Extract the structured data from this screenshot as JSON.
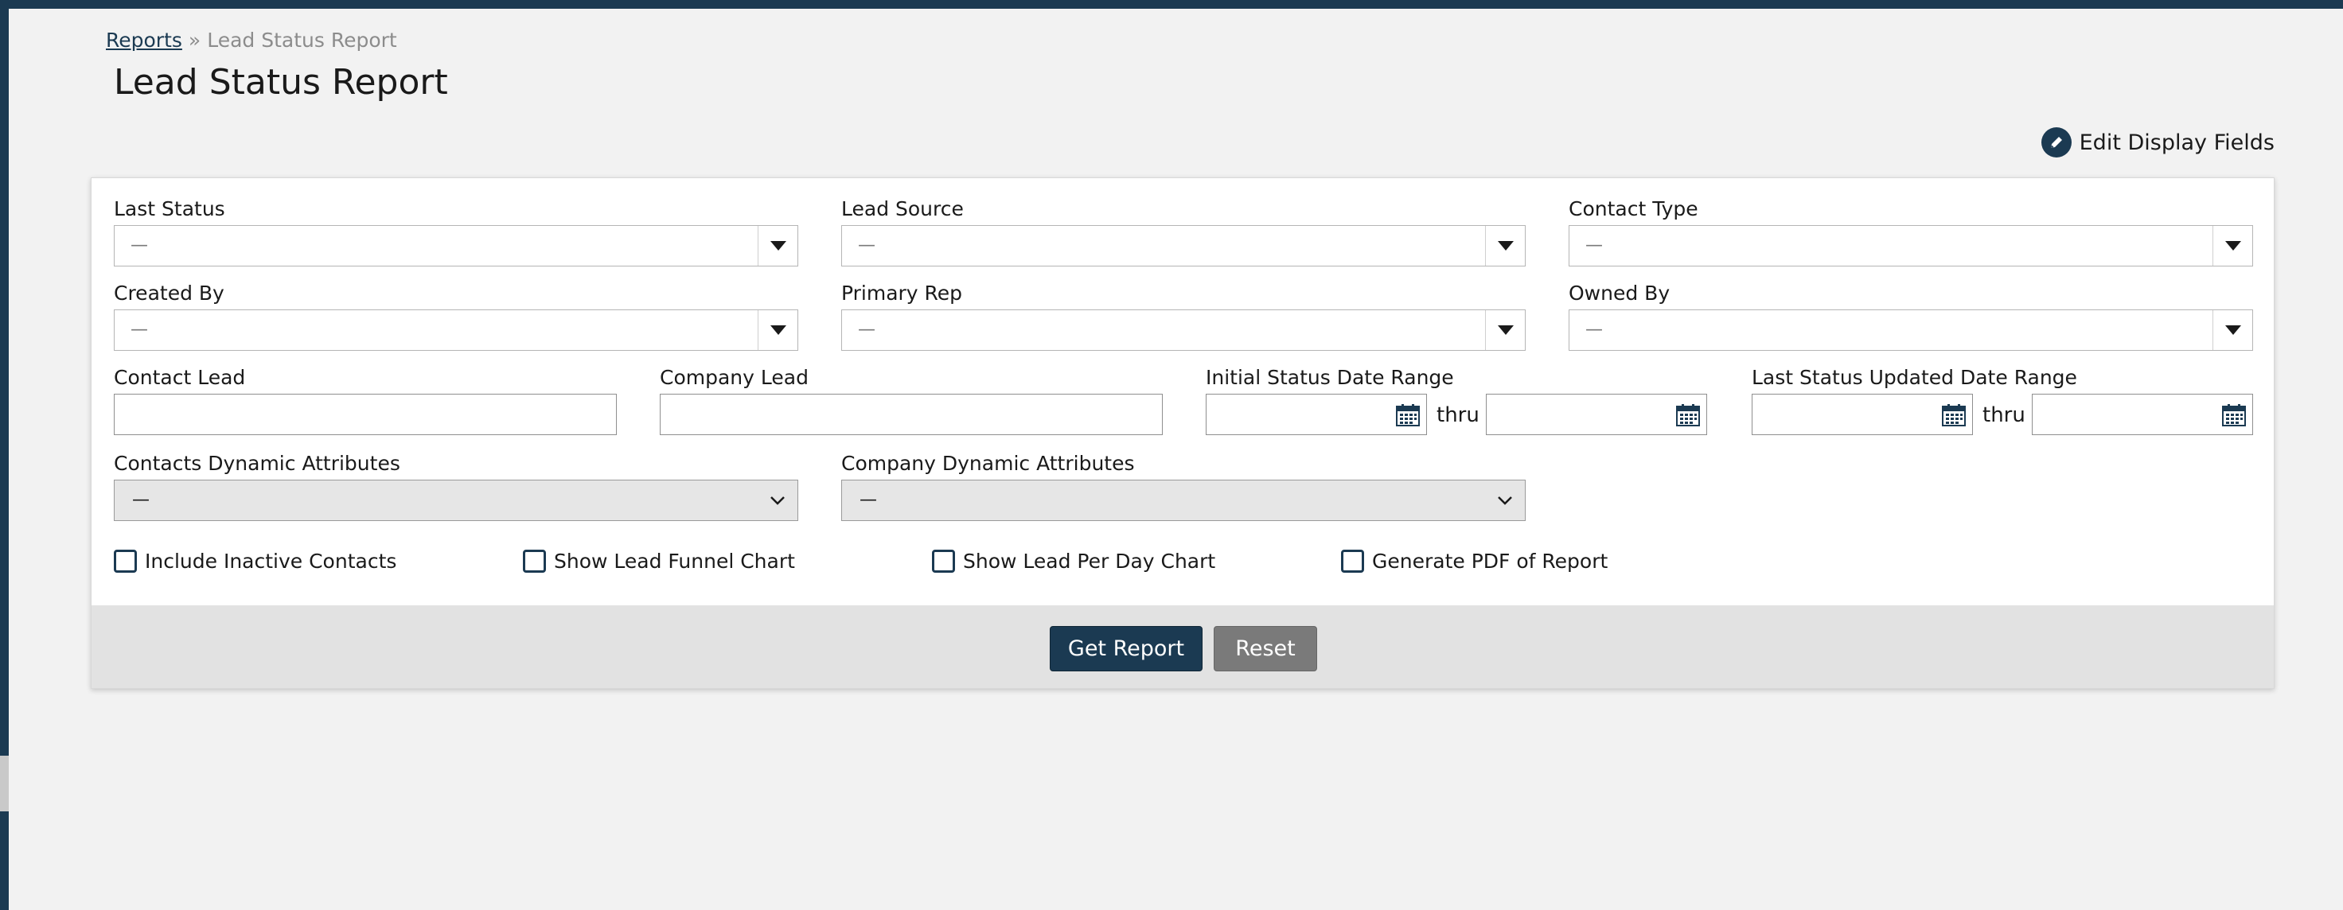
{
  "breadcrumb": {
    "parent": "Reports",
    "separator": "»",
    "current": "Lead Status Report"
  },
  "page": {
    "title": "Lead Status Report",
    "edit_fields": "Edit Display Fields"
  },
  "filters": {
    "last_status": {
      "label": "Last Status",
      "value": "—"
    },
    "lead_source": {
      "label": "Lead Source",
      "value": "—"
    },
    "contact_type": {
      "label": "Contact Type",
      "value": "—"
    },
    "created_by": {
      "label": "Created By",
      "value": "—"
    },
    "primary_rep": {
      "label": "Primary Rep",
      "value": "—"
    },
    "owned_by": {
      "label": "Owned By",
      "value": "—"
    },
    "contact_lead": {
      "label": "Contact Lead",
      "value": ""
    },
    "company_lead": {
      "label": "Company Lead",
      "value": ""
    },
    "initial_status_range": {
      "label": "Initial Status Date Range",
      "thru": "thru"
    },
    "last_status_updated_range": {
      "label": "Last Status Updated Date Range",
      "thru": "thru"
    },
    "contacts_dynamic": {
      "label": "Contacts Dynamic Attributes",
      "value": "—"
    },
    "company_dynamic": {
      "label": "Company Dynamic Attributes",
      "value": "—"
    }
  },
  "options": {
    "include_inactive": "Include Inactive Contacts",
    "funnel_chart": "Show Lead Funnel Chart",
    "per_day_chart": "Show Lead Per Day Chart",
    "generate_pdf": "Generate PDF of Report"
  },
  "actions": {
    "get_report": "Get Report",
    "reset": "Reset"
  },
  "colors": {
    "primary": "#1b3a52",
    "secondary": "#7a7a7a",
    "background": "#f2f2f2"
  }
}
